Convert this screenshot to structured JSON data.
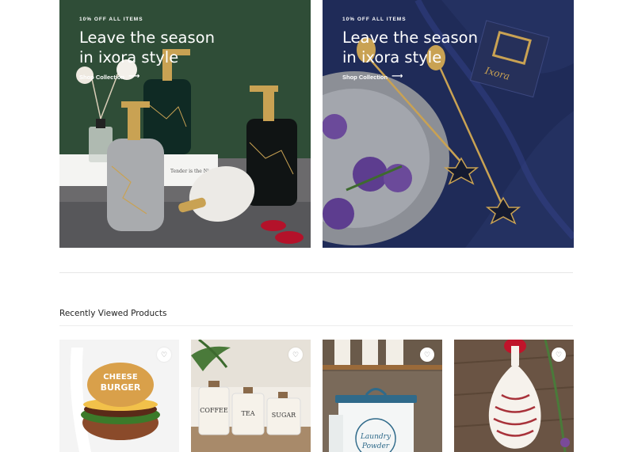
{
  "banners": [
    {
      "eyebrow": "10% OFF ALL ITEMS",
      "headline": "Leave the season in ixora style",
      "link": "Shop Collection",
      "arrow": "⟶"
    },
    {
      "eyebrow": "10% OFF ALL ITEMS",
      "headline": "Leave the season in ixora style",
      "link": "Shop Collection",
      "arrow": "⟶"
    }
  ],
  "recent": {
    "title": "Recently Viewed Products",
    "products": [
      {
        "image": "cheese-burger-magnet",
        "wishlist_icon": "♡"
      },
      {
        "image": "coffee-tea-sugar-canisters",
        "wishlist_icon": "♡"
      },
      {
        "image": "laundry-powder-tin",
        "wishlist_icon": "♡"
      },
      {
        "image": "striped-spoon-rest",
        "wishlist_icon": "♡"
      }
    ]
  },
  "image_text": {
    "burger": "CHEESE BURGER",
    "canisters": [
      "COFFEE",
      "TEA",
      "SUGAR"
    ],
    "laundry": [
      "Laundry",
      "Powder"
    ],
    "tag": "Ixora",
    "book": "Tender is the Night"
  },
  "colors": {
    "banner_left": "#2d4a35",
    "banner_right": "#1f2a55",
    "divider": "#e6e6e6"
  }
}
